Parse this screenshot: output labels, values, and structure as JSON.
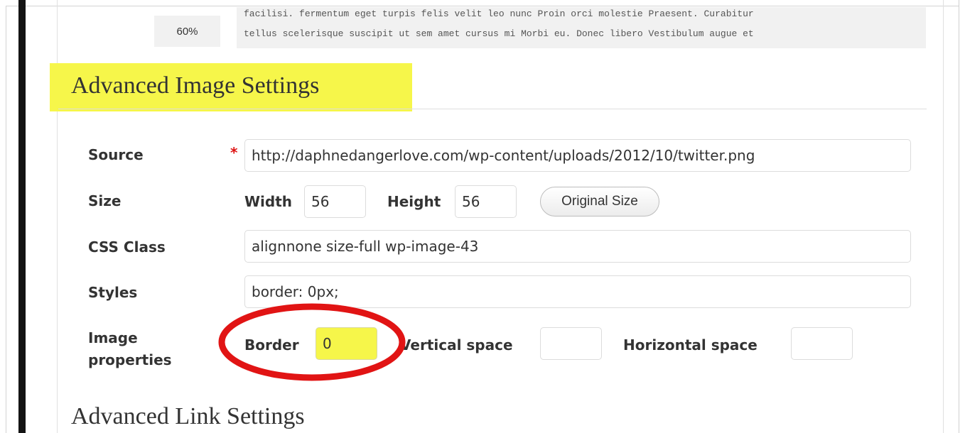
{
  "preview": {
    "percent": "60%",
    "line1": "facilisi. fermentum eget turpis felis velit leo nunc Proin orci molestie Praesent. Curabitur",
    "line2": "tellus scelerisque suscipit ut sem amet cursus mi Morbi eu. Donec libero Vestibulum augue et"
  },
  "image_settings": {
    "heading": "Advanced Image Settings",
    "source": {
      "label": "Source",
      "required_mark": "*",
      "value": "http://daphnedangerlove.com/wp-content/uploads/2012/10/twitter.png"
    },
    "size": {
      "label": "Size",
      "width_label": "Width",
      "width_value": "56",
      "height_label": "Height",
      "height_value": "56",
      "original_button": "Original Size"
    },
    "css_class": {
      "label": "CSS Class",
      "value": "alignnone size-full wp-image-43"
    },
    "styles": {
      "label": "Styles",
      "value": "border: 0px;"
    },
    "image_properties": {
      "label_line1": "Image",
      "label_line2": "properties",
      "border_label": "Border",
      "border_value": "0",
      "vertical_label": "Vertical space",
      "vertical_value": "",
      "horizontal_label": "Horizontal space",
      "horizontal_value": ""
    }
  },
  "link_settings": {
    "heading": "Advanced Link Settings"
  },
  "colors": {
    "highlight": "#f6f64a",
    "annotation": "#e11414",
    "required": "#dd1111"
  }
}
